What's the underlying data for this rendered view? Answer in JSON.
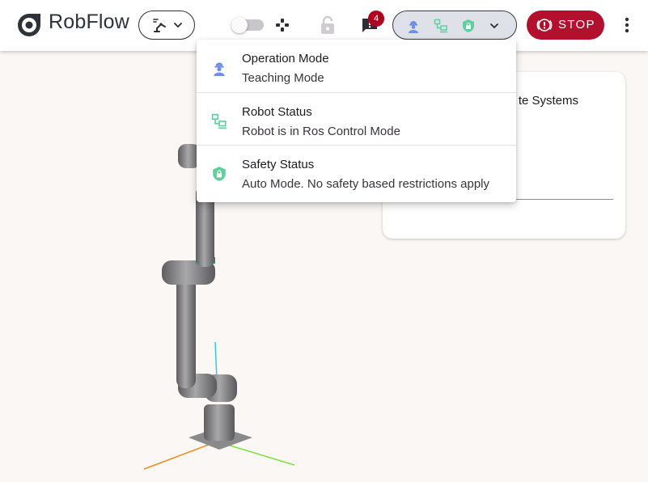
{
  "app": {
    "title": "RobFlow"
  },
  "header": {
    "notification_count": "4",
    "stop_label": "STOP"
  },
  "status_menu": {
    "items": [
      {
        "title": "Operation Mode",
        "value": "Teaching Mode",
        "icon": "worker-icon",
        "color": "#6b8fea"
      },
      {
        "title": "Robot Status",
        "value": "Robot is in Ros Control Mode",
        "icon": "robot-network-icon",
        "color": "#5fcf9e"
      },
      {
        "title": "Safety Status",
        "value": "Auto Mode. No safety based restrictions apply",
        "icon": "shield-lock-icon",
        "color": "#5fcf9e"
      }
    ]
  },
  "card": {
    "title": "te Systems"
  },
  "colors": {
    "stop": "#b3102e",
    "pill_bg": "#dfe1e8",
    "accent_blue": "#6b8fea",
    "accent_green": "#5fcf9e"
  }
}
